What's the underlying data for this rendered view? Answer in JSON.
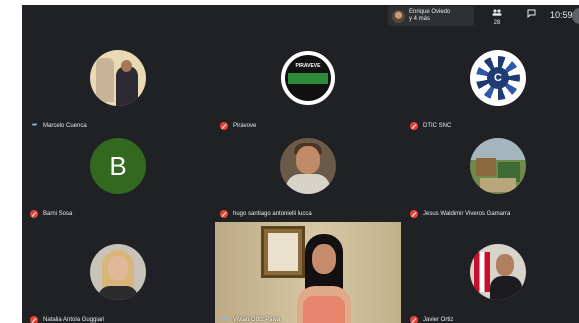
{
  "topbar": {
    "participants_names": "Enrique Oviedo",
    "participants_more": "y 4 más",
    "people_icon": "people-icon",
    "people_count": "28",
    "chat_icon": "chat-icon",
    "time": "10:59"
  },
  "status_icons": {
    "speaking": "speaking-dots-icon",
    "muted": "mic-off-icon"
  },
  "tiles": [
    {
      "name": "Marcelo Cuenca",
      "status": "speaking"
    },
    {
      "name": "Piravove",
      "status": "muted",
      "logo_text": "PIRAVEVE"
    },
    {
      "name": "DTIC SNC",
      "status": "muted",
      "logo_letter": "C"
    },
    {
      "name": "Barni Sosa",
      "status": "muted",
      "initial": "B"
    },
    {
      "name": "hugo santiago antonielli lucca",
      "status": "muted"
    },
    {
      "name": "Jesus Waldimir Viveros Gamarra",
      "status": "muted"
    },
    {
      "name": "Natalia Antola Guggiari",
      "status": "muted"
    },
    {
      "name": "Vivian Ortiz Paiva",
      "status": "speaking"
    },
    {
      "name": "Javier Ortiz",
      "status": "muted"
    }
  ],
  "colors": {
    "background": "#202124",
    "muted": "#ea4335",
    "speaking": "#8ab4f8",
    "initial_avatar": "#33691e"
  }
}
